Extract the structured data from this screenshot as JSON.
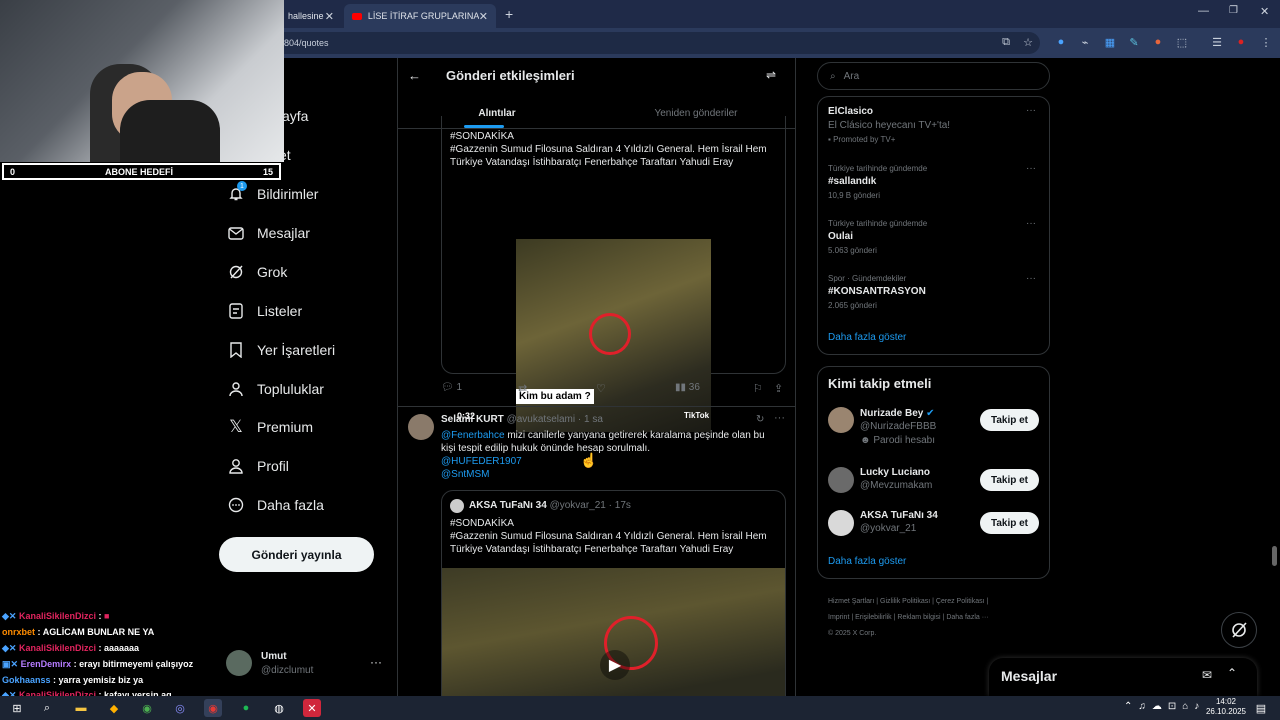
{
  "browser": {
    "tabs": [
      {
        "label": "hallesine",
        "icon": "x-icon"
      },
      {
        "label": "LİSE İTİRAF GRUPLARINA SIZDI",
        "icon": "youtube-icon"
      }
    ],
    "new_tab": "+",
    "url": "804/quotes"
  },
  "stream": {
    "goal_left": "0",
    "goal_label": "ABONE HEDEFİ",
    "goal_right": "15",
    "chat": [
      {
        "user": "KanaliSikilenDizci",
        "msg": ":",
        "color": "#e0245e"
      },
      {
        "user": "onrxbet",
        "msg": ": AGLİCAM BUNLAR NE YA",
        "color": "#ff8c00"
      },
      {
        "user": "KanaliSikilenDizci",
        "msg": ": aaaaaaa",
        "color": "#e0245e"
      },
      {
        "user": "ErenDemirx",
        "msg": ": erayı bitirmeyemi çalışıyoz",
        "color": "#b57cff"
      },
      {
        "user": "Gokhaanss",
        "msg": ": yarra yemisiz biz ya",
        "color": "#4aa3ff"
      },
      {
        "user": "KanaliSikilenDizci",
        "msg": ": kafayı yersin aq",
        "color": "#e0245e"
      }
    ]
  },
  "nav": {
    "items": [
      {
        "label": "sayfa",
        "icon": "home-icon"
      },
      {
        "label": "et",
        "icon": "search-icon"
      },
      {
        "label": "Bildirimler",
        "icon": "bell-icon",
        "badge": "1"
      },
      {
        "label": "Mesajlar",
        "icon": "mail-icon"
      },
      {
        "label": "Grok",
        "icon": "grok-icon"
      },
      {
        "label": "Listeler",
        "icon": "list-icon"
      },
      {
        "label": "Yer İşaretleri",
        "icon": "bookmark-icon"
      },
      {
        "label": "Topluluklar",
        "icon": "communities-icon"
      },
      {
        "label": "Premium",
        "icon": "x-logo-icon"
      },
      {
        "label": "Profil",
        "icon": "profile-icon"
      },
      {
        "label": "Daha fazla",
        "icon": "more-circle-icon"
      }
    ],
    "post_button": "Gönderi yayınla",
    "account_name": "Umut",
    "account_handle": "@dizclumut"
  },
  "center": {
    "header_title": "Gönderi etkileşimleri",
    "tabs": [
      "Alıntılar",
      "Yeniden gönderiler"
    ],
    "quoted1": {
      "lines": [
        "#SONDAKİKA",
        "#Gazzenin Sumud Filosuna Saldıran 4 Yıldızlı General. Hem İsrail Hem",
        "Türkiye Vatandaşı İstihbaratçı Fenerbahçe Taraftarı Yahudi Eray"
      ],
      "video_caption": "Kim bu adam ?",
      "video_time": "0:32",
      "video_brand": "TikTok"
    },
    "actions1": {
      "replies": "1",
      "retweets": "",
      "likes": "",
      "views": "36"
    },
    "tweet2": {
      "name": "Selami KURT",
      "handle": "@avukatselami",
      "time": "· 1 sa",
      "mention": "@Fenerbahce",
      "text_line1": "mizi canilerle yanyana getirerek karalama peşinde olan bu",
      "text_line2": "kişi tespit edilip hukuk önünde hesap sorulmalı.",
      "tag1": "@HUFEDER1907",
      "tag2": "@SntMSM"
    },
    "quoted2": {
      "name": "AKSA TuFaNı 34",
      "handle": "@yokvar_21",
      "time": "· 17s",
      "lines": [
        "#SONDAKİKA",
        "#Gazzenin Sumud Filosuna Saldıran 4 Yıldızlı General. Hem İsrail Hem",
        "Türkiye Vatandaşı İstihbaratçı Fenerbahçe Taraftarı Yahudi Eray"
      ]
    }
  },
  "right": {
    "search_placeholder": "Ara",
    "trends": [
      {
        "title": "ElClasico",
        "sub": "El Clásico heyecanı TV+'ta!",
        "meta": "Promoted by TV+"
      },
      {
        "context": "Türkiye tarihinde gündemde",
        "title": "#sallandık",
        "meta": "10,9 B gönderi"
      },
      {
        "context": "Türkiye tarihinde gündemde",
        "title": "Oulai",
        "meta": "5.063 gönderi"
      },
      {
        "context": "Spor · Gündemdekiler",
        "title": "#KONSANTRASYON",
        "meta": "2.065 gönderi"
      }
    ],
    "trends_more": "Daha fazla göster",
    "who_title": "Kimi takip etmeli",
    "who": [
      {
        "name": "Nurizade Bey",
        "handle": "@NurizadeFBBB",
        "note": "Parodi hesabı",
        "button": "Takip et"
      },
      {
        "name": "Lucky Luciano",
        "handle": "@Mevzumakam",
        "button": "Takip et"
      },
      {
        "name": "AKSA TuFaNı 34",
        "handle": "@yokvar_21",
        "button": "Takip et"
      }
    ],
    "who_more": "Daha fazla göster",
    "footer": [
      "Hizmet Şartları",
      "Gizlilik Politikası",
      "Çerez Politikası",
      "Imprint",
      "Erişilebilirlik",
      "Reklam bilgisi",
      "Daha fazla ···",
      "© 2025 X Corp."
    ],
    "messages_label": "Mesajlar"
  },
  "taskbar": {
    "time": "14:02",
    "date": "26.10.2025"
  }
}
